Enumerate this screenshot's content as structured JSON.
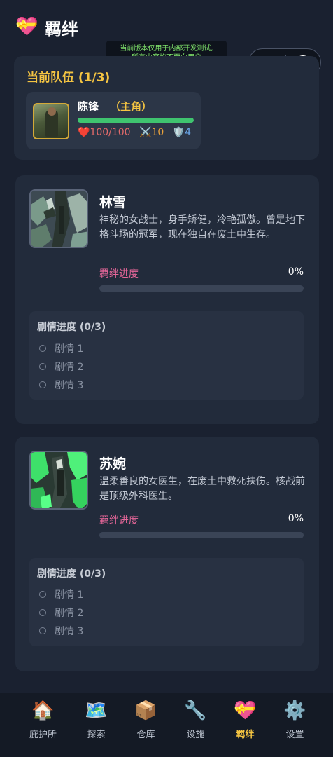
{
  "header": {
    "icon": "💝",
    "title": "羁绊"
  },
  "notice": {
    "line1": "当前版本仅用于内部开发测试,",
    "line2": "所有内容均不面向用户"
  },
  "capsule": {
    "more_icon": "•••"
  },
  "team": {
    "title": "当前队伍 (1/3)",
    "member": {
      "name": "陈锋",
      "role": "（主角）",
      "hp_fraction": 1.0,
      "hp_text": "❤️100/100",
      "atk_text": "⚔️10",
      "def_text": "🛡️4"
    }
  },
  "companions": [
    {
      "name": "林雪",
      "desc": "神秘的女战士，身手矫健，冷艳孤傲。曾是地下格斗场的冠军，现在独自在废土中生存。",
      "progress_label": "羁绊进度",
      "progress_text": "0%",
      "progress": 0,
      "story_title": "剧情进度 (0/3)",
      "stories": [
        "剧情 1",
        "剧情 2",
        "剧情 3"
      ]
    },
    {
      "name": "苏婉",
      "desc": "温柔善良的女医生，在废土中救死扶伤。核战前是顶级外科医生。",
      "progress_label": "羁绊进度",
      "progress_text": "0%",
      "progress": 0,
      "story_title": "剧情进度 (0/3)",
      "stories": [
        "剧情 1",
        "剧情 2",
        "剧情 3"
      ]
    }
  ],
  "tabs": [
    {
      "icon": "🏠",
      "label": "庇护所",
      "active": false
    },
    {
      "icon": "🗺️",
      "label": "探索",
      "active": false
    },
    {
      "icon": "📦",
      "label": "仓库",
      "active": false
    },
    {
      "icon": "🔧",
      "label": "设施",
      "active": false
    },
    {
      "icon": "💝",
      "label": "羁绊",
      "active": true
    },
    {
      "icon": "⚙️",
      "label": "设置",
      "active": false
    }
  ],
  "colors": {
    "accent": "#f5c542",
    "bond": "#e8679a",
    "hp": "#3fc46f",
    "background": "#1a2130"
  }
}
